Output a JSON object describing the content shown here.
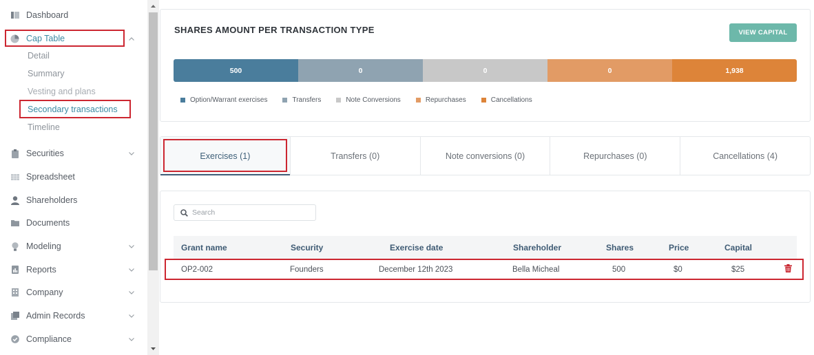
{
  "sidebar": {
    "items": [
      {
        "label": "Dashboard",
        "icon": "dashboard-icon"
      },
      {
        "label": "Cap Table",
        "icon": "pie-chart-icon"
      },
      {
        "label": "Securities",
        "icon": "clipboard-icon"
      },
      {
        "label": "Spreadsheet",
        "icon": "spreadsheet-icon"
      },
      {
        "label": "Shareholders",
        "icon": "person-icon"
      },
      {
        "label": "Documents",
        "icon": "folder-icon"
      },
      {
        "label": "Modeling",
        "icon": "lightbulb-icon"
      },
      {
        "label": "Reports",
        "icon": "report-icon"
      },
      {
        "label": "Company",
        "icon": "building-icon"
      },
      {
        "label": "Admin Records",
        "icon": "records-icon"
      },
      {
        "label": "Compliance",
        "icon": "check-badge-icon"
      }
    ],
    "cap_table_sub": [
      "Detail",
      "Summary",
      "Vesting and plans",
      "Secondary transactions",
      "Timeline"
    ]
  },
  "chart": {
    "title": "SHARES AMOUNT PER TRANSACTION TYPE",
    "view_button": "VIEW CAPITAL"
  },
  "chart_data": {
    "type": "bar",
    "title": "SHARES AMOUNT PER TRANSACTION TYPE",
    "orientation": "stacked-horizontal",
    "segments": [
      {
        "name": "Option/Warrant exercises",
        "label": "500",
        "color": "#4a7d9c"
      },
      {
        "name": "Transfers",
        "label": "0",
        "color": "#8fa3b1"
      },
      {
        "name": "Note Conversions",
        "label": "0",
        "color": "#c8c8c8"
      },
      {
        "name": "Repurchases",
        "label": "0",
        "color": "#e29b65"
      },
      {
        "name": "Cancellations",
        "label": "1,938",
        "color": "#dd8439"
      }
    ],
    "legend_position": "bottom-left"
  },
  "tabs": [
    {
      "label": "Exercises (1)"
    },
    {
      "label": "Transfers (0)"
    },
    {
      "label": "Note conversions (0)"
    },
    {
      "label": "Repurchases (0)"
    },
    {
      "label": "Cancellations (4)"
    }
  ],
  "search": {
    "placeholder": "Search"
  },
  "table": {
    "columns": [
      "Grant name",
      "Security",
      "Exercise date",
      "Shareholder",
      "Shares",
      "Price",
      "Capital"
    ],
    "rows": [
      [
        "OP2-002",
        "Founders",
        "December 12th 2023",
        "Bella Micheal",
        "500",
        "$0",
        "$25"
      ]
    ]
  },
  "colors": {
    "accent": "#3c8aa3",
    "highlight_box": "#cc2630",
    "button": "#6db8aa",
    "header_text": "#3f5b74",
    "delete_icon": "#c8242e"
  }
}
